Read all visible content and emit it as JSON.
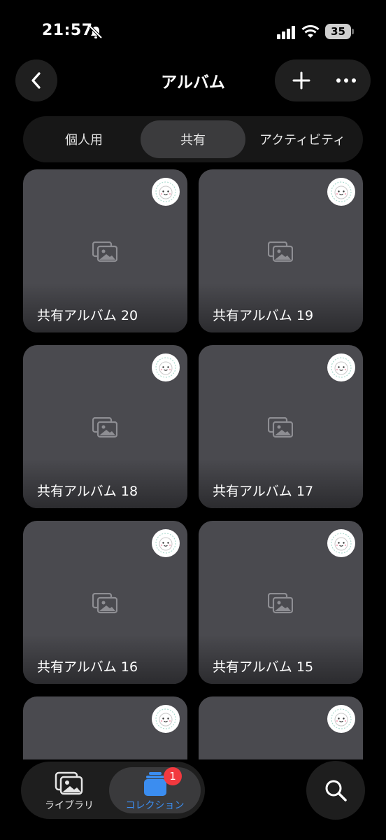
{
  "status_bar": {
    "time": "21:57",
    "battery": "35"
  },
  "header": {
    "title": "アルバム"
  },
  "segments": [
    {
      "label": "個人用",
      "selected": false
    },
    {
      "label": "共有",
      "selected": true
    },
    {
      "label": "アクティビティ",
      "selected": false
    }
  ],
  "albums": [
    {
      "name": "共有アルバム 20"
    },
    {
      "name": "共有アルバム 19"
    },
    {
      "name": "共有アルバム 18"
    },
    {
      "name": "共有アルバム 17"
    },
    {
      "name": "共有アルバム 16"
    },
    {
      "name": "共有アルバム 15"
    },
    {
      "name": ""
    },
    {
      "name": ""
    }
  ],
  "tab_bar": {
    "library_label": "ライブラリ",
    "collection_label": "コレクション",
    "collection_badge": "1",
    "active_tab": "collection"
  },
  "colors": {
    "accent": "#3b8df0",
    "badge": "#f2393f",
    "card": "#4a4a4f",
    "background": "#000000"
  }
}
